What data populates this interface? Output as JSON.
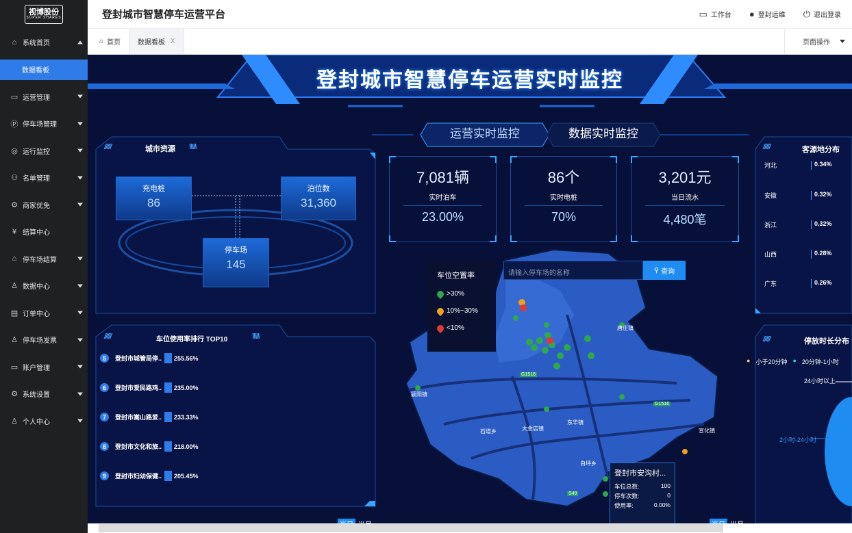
{
  "sidebar": {
    "logo_text": "视博股份",
    "logo_sub": "SUPER SHARES",
    "items": [
      {
        "label": "系统首页"
      },
      {
        "label": "数据看板"
      },
      {
        "label": "运营管理"
      },
      {
        "label": "停车场管理"
      },
      {
        "label": "运行监控"
      },
      {
        "label": "名单管理"
      },
      {
        "label": "商家优免"
      },
      {
        "label": "结算中心"
      },
      {
        "label": "停车场结算"
      },
      {
        "label": "数据中心"
      },
      {
        "label": "订单中心"
      },
      {
        "label": "停车场发票"
      },
      {
        "label": "账户管理"
      },
      {
        "label": "系统设置"
      },
      {
        "label": "个人中心"
      }
    ]
  },
  "header": {
    "title": "登封城市智慧停车运营平台",
    "workbench": "工作台",
    "user": "登封运维",
    "logout": "退出登录"
  },
  "tabs": {
    "home": "首页",
    "current": "数据看板",
    "close": "X",
    "page_ops": "页面操作"
  },
  "dashboard": {
    "title": "登封城市智慧停车运营实时监控",
    "tab_ops": "运营实时监控",
    "tab_data": "数据实时监控",
    "city": {
      "title": "城市资源",
      "charging_label": "充电桩",
      "charging_value": "86",
      "berth_label": "泊位数",
      "berth_value": "31,360",
      "lot_label": "停车场",
      "lot_value": "145"
    },
    "kpis": [
      {
        "v1": "7,081辆",
        "label": "实时泊车",
        "v2": "23.00%"
      },
      {
        "v1": "86个",
        "label": "实时电桩",
        "v2": "70%"
      },
      {
        "v1": "3,201元",
        "label": "当日流水",
        "v2": "4,480笔"
      }
    ],
    "ranking": {
      "title": "车位使用率排行 TOP10",
      "rows": [
        {
          "n": "5",
          "name": "登封市城管局停..",
          "pct": "255.56%"
        },
        {
          "n": "6",
          "name": "登封市爱民路鸡..",
          "pct": "235.00%"
        },
        {
          "n": "7",
          "name": "登封市嵩山路爱..",
          "pct": "233.33%"
        },
        {
          "n": "8",
          "name": "登封市文化和旅..",
          "pct": "218.00%"
        },
        {
          "n": "9",
          "name": "登封市妇幼保健..",
          "pct": "205.45%"
        }
      ]
    },
    "sources": {
      "title": "客源地分布",
      "rows": [
        {
          "name": "河北",
          "pct": "0.34%"
        },
        {
          "name": "安徽",
          "pct": "0.32%"
        },
        {
          "name": "浙江",
          "pct": "0.32%"
        },
        {
          "name": "山西",
          "pct": "0.28%"
        },
        {
          "name": "广东",
          "pct": "0.26%"
        }
      ]
    },
    "duration": {
      "title": "停放时长分布",
      "legend1": "小于20分钟",
      "legend2": "20分钟-1小时",
      "label1": "24小时以上",
      "label2": "2小时-24小时"
    },
    "map": {
      "legend_title": "车位空置率",
      "legend": [
        ">30%",
        "10%~30%",
        "<10%"
      ],
      "search_placeholder": "请输入停车场的名称",
      "search_btn": "查询",
      "places": [
        "石道乡",
        "大金店镇",
        "东华镇",
        "宣化镇",
        "白坪乡",
        "颍阳镇",
        "唐庄镇"
      ],
      "road_tags": [
        "G1516",
        "G1516",
        "S49"
      ],
      "colors": {
        "green": "#2ea84b",
        "orange": "#f0a020",
        "red": "#e03b2c"
      },
      "tooltip": {
        "title": "登封市安沟村...",
        "rows": [
          {
            "k": "车位总数:",
            "v": "100"
          },
          {
            "k": "停车次数:",
            "v": "0"
          },
          {
            "k": "使用率:",
            "v": "0.00%"
          }
        ]
      }
    },
    "mini_tabs": [
      "当日",
      "当月"
    ]
  }
}
